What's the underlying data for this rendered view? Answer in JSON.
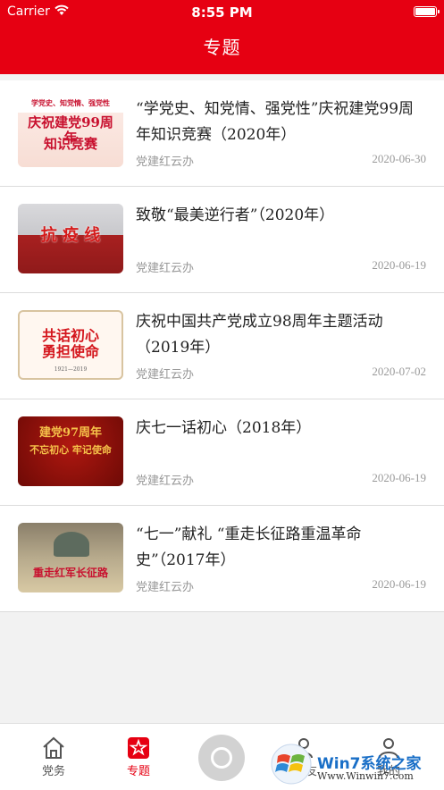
{
  "status_bar": {
    "carrier": "Carrier",
    "time": "8:55 PM"
  },
  "header": {
    "title": "专题"
  },
  "items": [
    {
      "title": "“学党史、知党情、强党性”庆祝建党99周年知识竞赛（2020年）",
      "source": "党建红云办",
      "date": "2020-06-30",
      "thumb_text": [
        "学党史、知党情、强党性",
        "庆祝建党99周年",
        "知识竞赛"
      ]
    },
    {
      "title": "致敬“最美逆行者”（2020年）",
      "source": "党建红云办",
      "date": "2020-06-19",
      "thumb_text": [
        "抗  疫  线"
      ]
    },
    {
      "title": "庆祝中国共产党成立98周年主题活动（2019年）",
      "source": "党建红云办",
      "date": "2020-07-02",
      "thumb_text": [
        "共话初心",
        "勇担使命",
        "1921—2019"
      ]
    },
    {
      "title": "庆七一话初心（2018年）",
      "source": "党建红云办",
      "date": "2020-06-19",
      "thumb_text": [
        "建党97周年",
        "不忘初心 牢记使命"
      ]
    },
    {
      "title": "“七一”献礼 “重走长征路重温革命史”（2017年）",
      "source": "党建红云办",
      "date": "2020-06-19",
      "thumb_text": [
        "重走红军长征路"
      ]
    }
  ],
  "tabbar": {
    "tab1": "党务",
    "tab2": "专题",
    "tab4": "党友",
    "tab5": "我的"
  },
  "watermark": {
    "text": "Win7系统之家",
    "url": "Www.Winwin7.com"
  },
  "colors": {
    "brand_red": "#e60012",
    "muted": "#999999"
  }
}
